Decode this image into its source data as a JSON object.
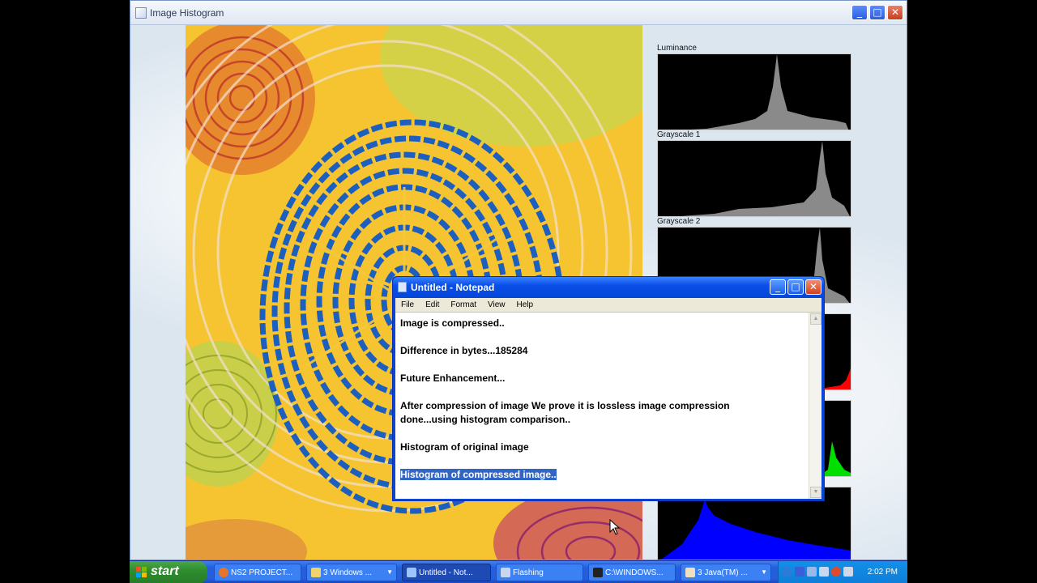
{
  "main_window": {
    "title": "Image Histogram"
  },
  "histograms": [
    {
      "label": "Luminance",
      "color": "#8a8a8a"
    },
    {
      "label": "Grayscale 1",
      "color": "#8a8a8a"
    },
    {
      "label": "Grayscale 2",
      "color": "#8a8a8a"
    },
    {
      "label": "",
      "color": "#ff0000"
    },
    {
      "label": "",
      "color": "#00e000"
    },
    {
      "label": "",
      "color": "#0000ff"
    }
  ],
  "notepad": {
    "title": "Untitled - Notepad",
    "menu": [
      "File",
      "Edit",
      "Format",
      "View",
      "Help"
    ],
    "lines": [
      "Image is compressed..",
      "",
      "Difference in bytes...185284",
      "",
      "Future Enhancement...",
      "",
      "After compression of image We prove it is lossless image compression",
      "done...using histogram comparison..",
      "",
      "Histogram of original image",
      "",
      "Histogram of compressed image.."
    ],
    "selected_line_index": 11
  },
  "taskbar": {
    "start_label": "start",
    "buttons": [
      {
        "label": "NS2 PROJECT...",
        "icon": "firefox-icon",
        "icon_color": "#e8742a"
      },
      {
        "label": "3 Windows ...",
        "icon": "folder-icon",
        "icon_color": "#f2d36b",
        "has_group": true
      },
      {
        "label": "Untitled - Not...",
        "icon": "notepad-icon",
        "icon_color": "#9ec4ff",
        "active": true
      },
      {
        "label": "Flashing",
        "icon": "app-icon",
        "icon_color": "#c8d6f0"
      },
      {
        "label": "C:\\WINDOWS...",
        "icon": "cmd-icon",
        "icon_color": "#222222"
      },
      {
        "label": "3 Java(TM) ...",
        "icon": "java-icon",
        "icon_color": "#f0e0c0",
        "has_group": true
      }
    ],
    "clock": "2:02 PM"
  }
}
